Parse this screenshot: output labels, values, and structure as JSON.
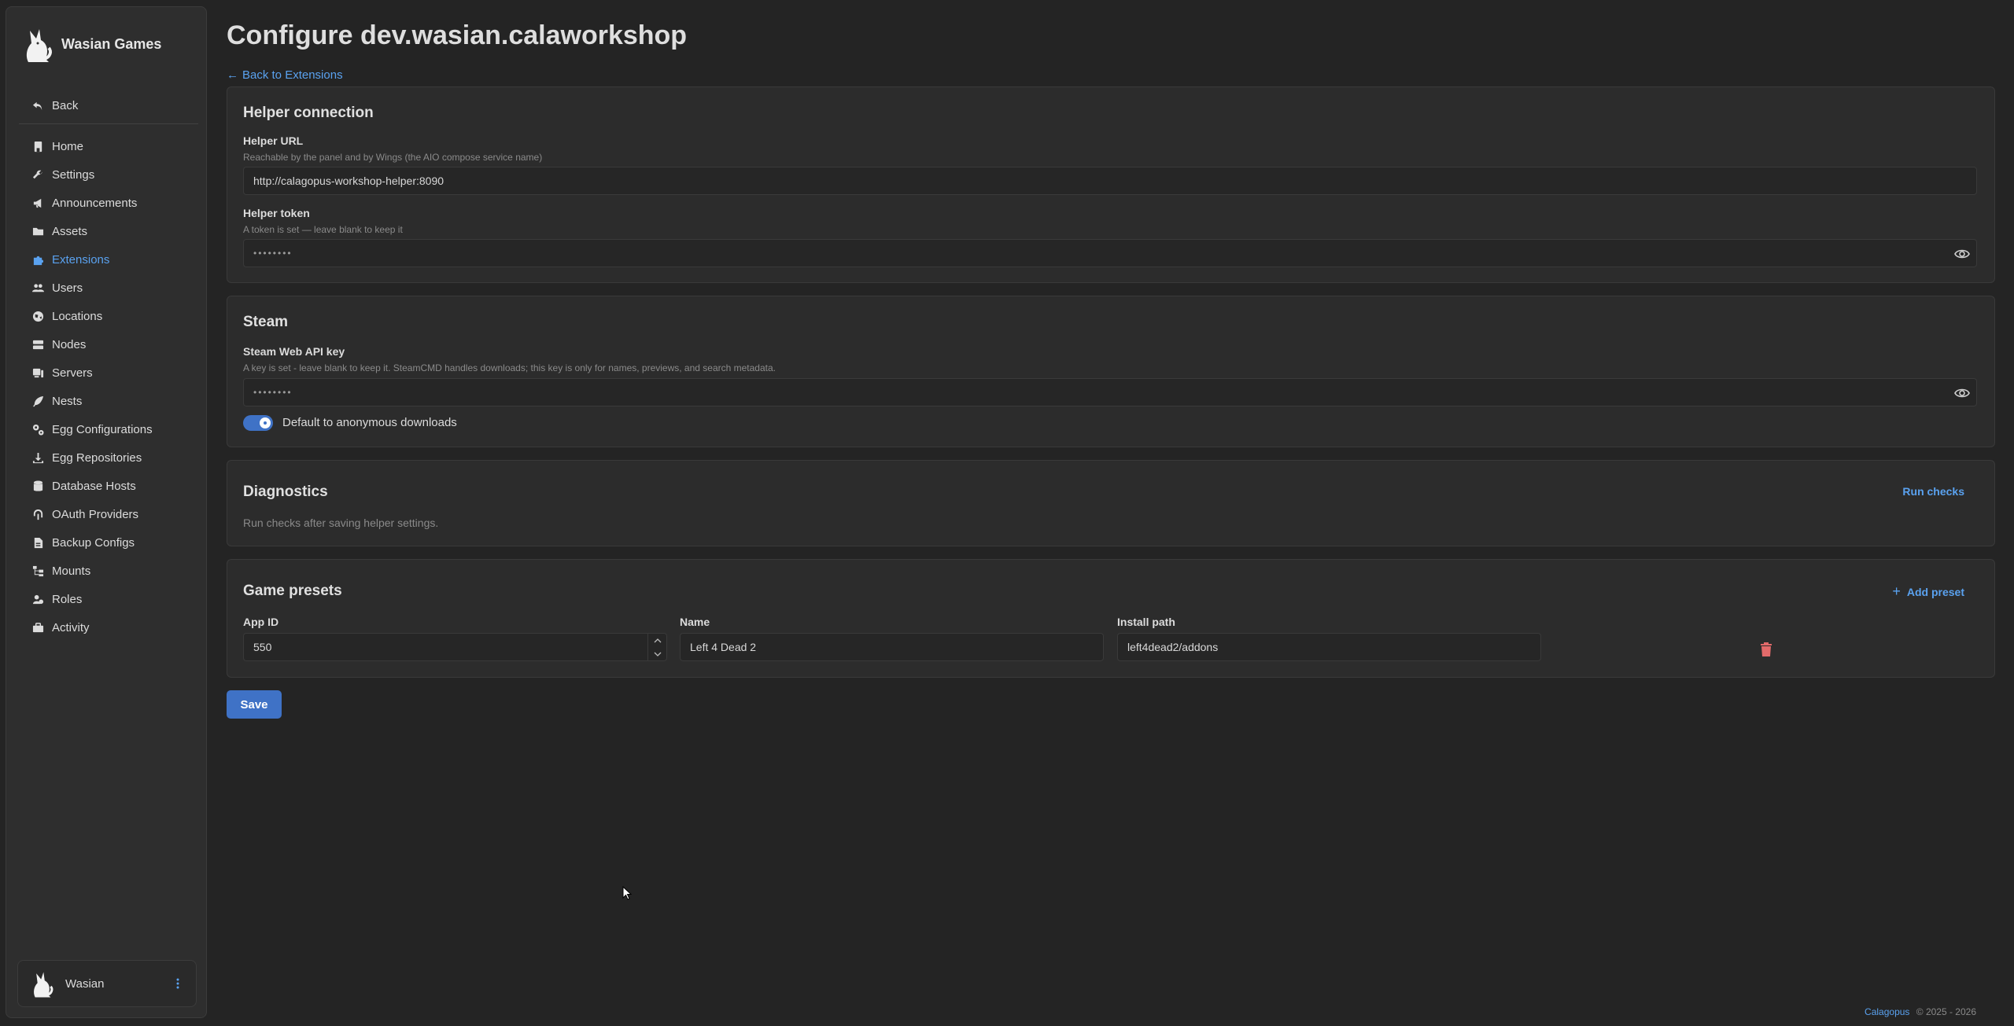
{
  "brand": {
    "name": "Wasian Games"
  },
  "sidebar": {
    "back_label": "Back",
    "items": [
      {
        "label": "Home",
        "icon": "home-icon"
      },
      {
        "label": "Settings",
        "icon": "wrench-icon"
      },
      {
        "label": "Announcements",
        "icon": "megaphone-icon"
      },
      {
        "label": "Assets",
        "icon": "folder-icon"
      },
      {
        "label": "Extensions",
        "icon": "puzzle-icon",
        "active": true
      },
      {
        "label": "Users",
        "icon": "users-icon"
      },
      {
        "label": "Locations",
        "icon": "globe-icon"
      },
      {
        "label": "Nodes",
        "icon": "server-icon"
      },
      {
        "label": "Servers",
        "icon": "servers-icon"
      },
      {
        "label": "Nests",
        "icon": "feather-icon"
      },
      {
        "label": "Egg Configurations",
        "icon": "gears-icon"
      },
      {
        "label": "Egg Repositories",
        "icon": "download-icon"
      },
      {
        "label": "Database Hosts",
        "icon": "database-icon"
      },
      {
        "label": "OAuth Providers",
        "icon": "fingerprint-icon"
      },
      {
        "label": "Backup Configs",
        "icon": "file-icon"
      },
      {
        "label": "Mounts",
        "icon": "tree-icon"
      },
      {
        "label": "Roles",
        "icon": "roles-icon"
      },
      {
        "label": "Activity",
        "icon": "briefcase-icon"
      }
    ],
    "user": {
      "name": "Wasian"
    }
  },
  "page": {
    "title": "Configure dev.wasian.calaworkshop",
    "back_link": "Back to Extensions"
  },
  "helper": {
    "title": "Helper connection",
    "url_label": "Helper URL",
    "url_hint": "Reachable by the panel and by Wings (the AIO compose service name)",
    "url_value": "http://calagopus-workshop-helper:8090",
    "token_label": "Helper token",
    "token_hint": "A token is set — leave blank to keep it",
    "token_value": "••••••••"
  },
  "steam": {
    "title": "Steam",
    "key_label": "Steam Web API key",
    "key_hint": "A key is set - leave blank to keep it. SteamCMD handles downloads; this key is only for names, previews, and search metadata.",
    "key_value": "••••••••",
    "anon_label": "Default to anonymous downloads",
    "anon_enabled": true
  },
  "diagnostics": {
    "title": "Diagnostics",
    "run_label": "Run checks",
    "hint": "Run checks after saving helper settings."
  },
  "presets": {
    "title": "Game presets",
    "add_label": "Add preset",
    "col_app_id": "App ID",
    "col_name": "Name",
    "col_path": "Install path",
    "rows": [
      {
        "app_id": "550",
        "name": "Left 4 Dead 2",
        "path": "left4dead2/addons"
      }
    ]
  },
  "save_label": "Save",
  "footer": {
    "link": "Calagopus",
    "text": "© 2025 - 2026"
  },
  "colors": {
    "accent": "#5aa2f0",
    "primary_button": "#3f72c6",
    "danger": "#e26a6a",
    "background": "#242424"
  }
}
